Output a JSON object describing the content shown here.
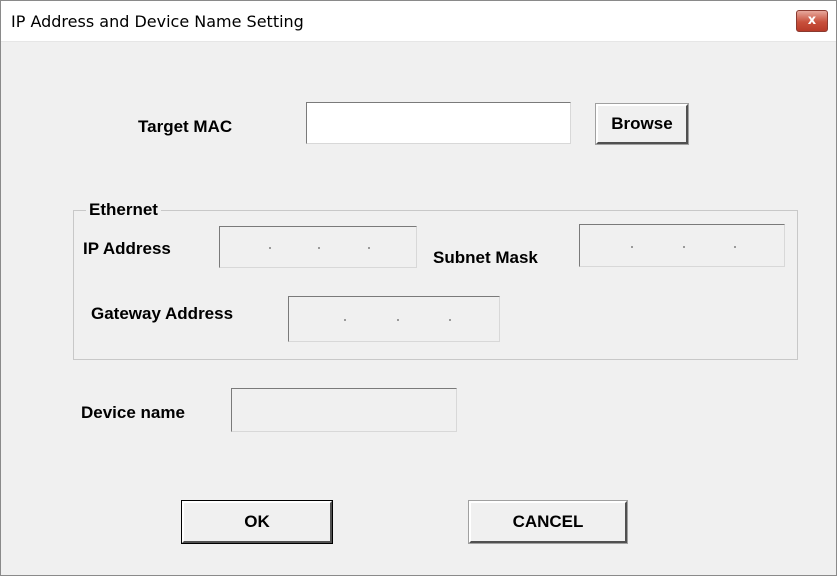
{
  "window": {
    "title": "IP Address and Device Name Setting",
    "close_glyph": "x"
  },
  "target_mac": {
    "label": "Target MAC",
    "value": "",
    "browse_label": "Browse"
  },
  "ethernet": {
    "group_title": "Ethernet",
    "ip_address": {
      "label": "IP Address",
      "separators": [
        ".",
        ".",
        "."
      ]
    },
    "subnet_mask": {
      "label": "Subnet Mask",
      "separators": [
        ".",
        ".",
        "."
      ]
    },
    "gateway_address": {
      "label": "Gateway Address",
      "separators": [
        ".",
        ".",
        "."
      ]
    }
  },
  "device_name": {
    "label": "Device name",
    "value": ""
  },
  "footer": {
    "ok_label": "OK",
    "cancel_label": "CANCEL"
  },
  "colors": {
    "dialog_bg": "#f0f0f0",
    "titlebar_bg": "#ffffff",
    "close_button": "#c8503c"
  },
  "icons": {
    "close": "close-icon"
  }
}
